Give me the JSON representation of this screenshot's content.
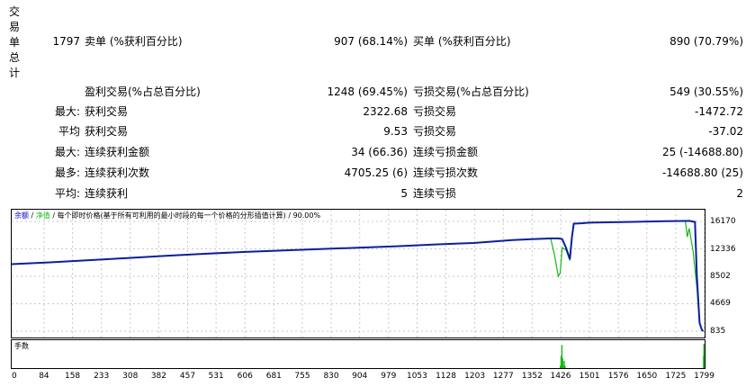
{
  "report": {
    "section_label": [
      "交",
      "易",
      "单",
      "总",
      "计"
    ],
    "total_trades": "1797",
    "sell_label": "卖单 (%获利百分比)",
    "sell_value": "907 (68.14%)",
    "buy_label": "买单 (%获利百分比)",
    "buy_value": "890 (70.79%)",
    "profit_trades_label": "盈利交易(%占总百分比)",
    "profit_trades_value": "1248 (69.45%)",
    "loss_trades_label": "亏损交易(%占总百分比)",
    "loss_trades_value": "549 (30.55%)",
    "rows": [
      {
        "prefix": "最大:",
        "left_label": "获利交易",
        "left_value": "2322.68",
        "right_label": "亏损交易",
        "right_value": "-1472.72"
      },
      {
        "prefix": "平均",
        "left_label": "获利交易",
        "left_value": "9.53",
        "right_label": "亏损交易",
        "right_value": "-37.02"
      },
      {
        "prefix": "最大:",
        "left_label": "连续获利金额",
        "left_value": "34 (66.36)",
        "right_label": "连续亏损金额",
        "right_value": "25 (-14688.80)"
      },
      {
        "prefix": "最多:",
        "left_label": "连续获利次数",
        "left_value": "4705.25 (6)",
        "right_label": "连续亏损次数",
        "right_value": "-14688.80 (25)"
      },
      {
        "prefix": "平均:",
        "left_label": "连续获利",
        "left_value": "5",
        "right_label": "连续亏损",
        "right_value": "2"
      }
    ]
  },
  "chart": {
    "legend_balance": "余额",
    "legend_sep1": " / ",
    "legend_equity": "净值",
    "legend_rest": " / 每个即时价格(基于所有可利用的最小时段的每一个价格的分形插值计算) / 90.00%",
    "volume_label": "手数",
    "colors": {
      "balance": "#0b1f9c",
      "equity": "#14b814",
      "grid": "#c8c8c8",
      "legend_blue": "#0000cc"
    }
  },
  "chart_data": {
    "type": "line",
    "x_ticks": [
      "0",
      "84",
      "158",
      "233",
      "308",
      "382",
      "457",
      "531",
      "606",
      "681",
      "755",
      "830",
      "904",
      "979",
      "1053",
      "1128",
      "1203",
      "1277",
      "1352",
      "1426",
      "1501",
      "1576",
      "1650",
      "1725",
      "1799"
    ],
    "y_ticks": [
      "16170",
      "12336",
      "8502",
      "4669",
      "835"
    ],
    "xlim": [
      0,
      1800
    ],
    "ylim": [
      835,
      16170
    ],
    "series": [
      {
        "key": "balance",
        "x": [
          0,
          100,
          200,
          300,
          400,
          500,
          600,
          700,
          800,
          900,
          1000,
          1100,
          1200,
          1250,
          1300,
          1350,
          1380,
          1400,
          1420,
          1430,
          1440,
          1450,
          1455,
          1460,
          1480,
          1500,
          1600,
          1700,
          1760,
          1775,
          1780,
          1787,
          1793,
          1797
        ],
        "y": [
          10200,
          10450,
          10750,
          11050,
          11350,
          11650,
          11900,
          12100,
          12300,
          12500,
          12700,
          12950,
          13150,
          13350,
          13550,
          13700,
          13750,
          13800,
          13800,
          13700,
          12500,
          10900,
          13800,
          15850,
          15900,
          16000,
          16100,
          16200,
          16250,
          16100,
          8500,
          2000,
          1000,
          835
        ]
      },
      {
        "key": "equity",
        "x": [
          0,
          100,
          200,
          300,
          400,
          500,
          600,
          700,
          800,
          900,
          1000,
          1100,
          1200,
          1250,
          1300,
          1350,
          1380,
          1400,
          1410,
          1420,
          1425,
          1430,
          1440,
          1450,
          1455,
          1460,
          1500,
          1600,
          1700,
          1750,
          1755,
          1760,
          1770,
          1780,
          1787,
          1793,
          1797
        ],
        "y": [
          10200,
          10450,
          10750,
          11050,
          11350,
          11650,
          11900,
          12100,
          12300,
          12500,
          12700,
          12950,
          13150,
          13350,
          13550,
          13700,
          13750,
          13800,
          11500,
          8500,
          9000,
          12500,
          12200,
          10700,
          13800,
          15850,
          16000,
          16100,
          16200,
          16240,
          14000,
          15200,
          12000,
          7000,
          2000,
          1100,
          835
        ]
      }
    ],
    "volume": {
      "x": [
        1425,
        1427,
        1429,
        1431,
        1433,
        1435,
        1437,
        1797,
        1798,
        1799
      ],
      "v": [
        0.1,
        0.5,
        0.95,
        0.4,
        0.1,
        0.3,
        0.1,
        0.5,
        1.0,
        0.6
      ]
    }
  }
}
